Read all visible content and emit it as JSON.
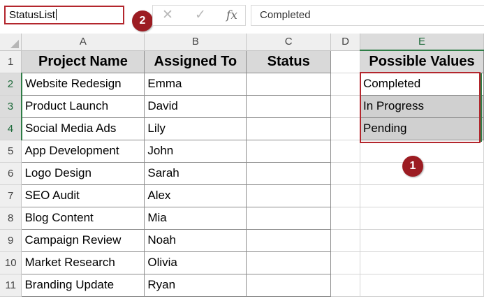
{
  "name_box": {
    "value": "StatusList"
  },
  "formula_bar": {
    "cancel_glyph": "✕",
    "enter_glyph": "✓",
    "fx_label": "fx",
    "value": "Completed"
  },
  "annotations": {
    "badge_1": "1",
    "badge_2": "2"
  },
  "columns": [
    "A",
    "B",
    "C",
    "D",
    "E"
  ],
  "row_numbers": [
    "1",
    "2",
    "3",
    "4",
    "5",
    "6",
    "7",
    "8",
    "9",
    "10",
    "11"
  ],
  "table": {
    "headers": {
      "project": "Project Name",
      "assigned": "Assigned To",
      "status": "Status"
    },
    "rows": [
      {
        "project": "Website Redesign",
        "assigned": "Emma",
        "status": ""
      },
      {
        "project": "Product Launch",
        "assigned": "David",
        "status": ""
      },
      {
        "project": "Social Media Ads",
        "assigned": "Lily",
        "status": ""
      },
      {
        "project": "App Development",
        "assigned": "John",
        "status": ""
      },
      {
        "project": "Logo Design",
        "assigned": "Sarah",
        "status": ""
      },
      {
        "project": "SEO Audit",
        "assigned": "Alex",
        "status": ""
      },
      {
        "project": "Blog Content",
        "assigned": "Mia",
        "status": ""
      },
      {
        "project": "Campaign Review",
        "assigned": "Noah",
        "status": ""
      },
      {
        "project": "Market Research",
        "assigned": "Olivia",
        "status": ""
      },
      {
        "project": "Branding Update",
        "assigned": "Ryan",
        "status": ""
      }
    ]
  },
  "possible_values": {
    "header": "Possible Values",
    "items": [
      "Completed",
      "In Progress",
      "Pending"
    ]
  },
  "colors": {
    "annotation": "#9c1c22",
    "selection": "#2e7d46",
    "header_fill": "#d9d9d9"
  }
}
